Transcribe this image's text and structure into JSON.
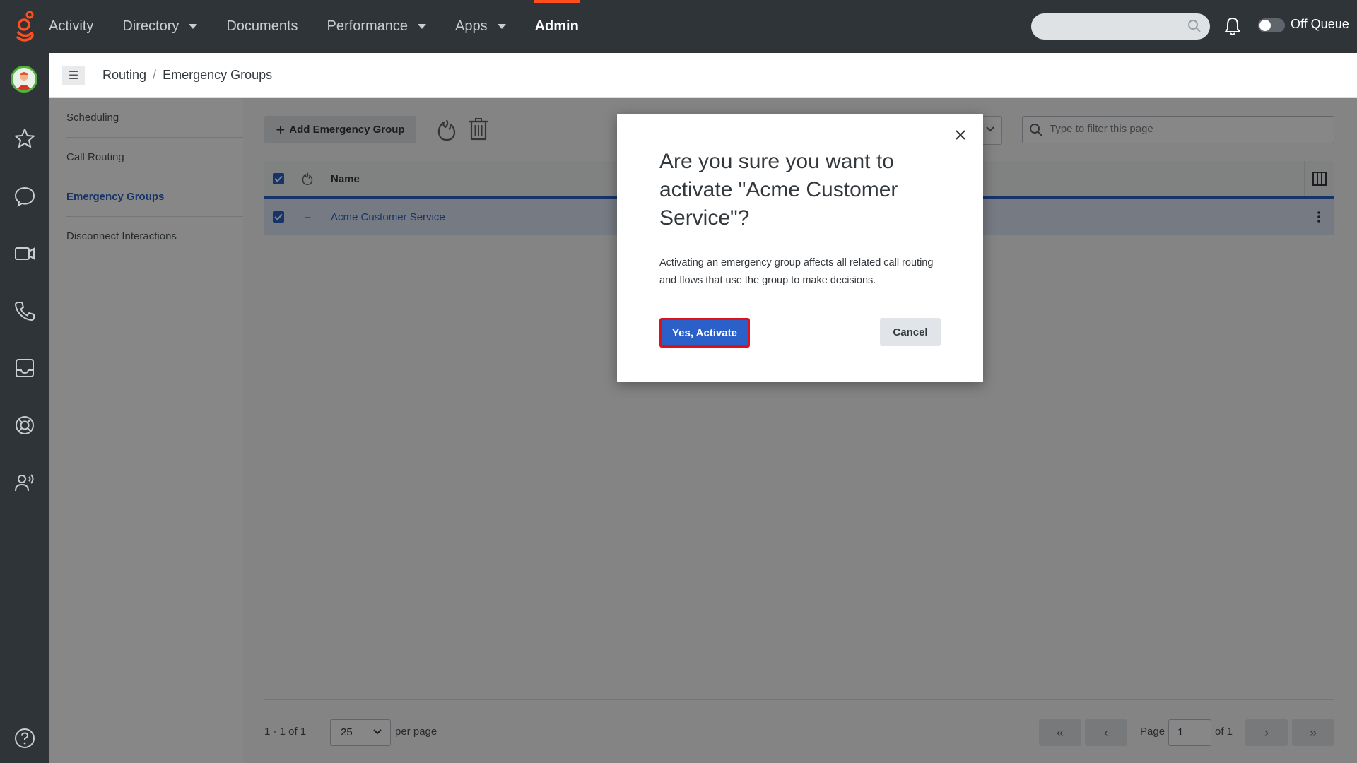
{
  "topbar": {
    "nav": [
      {
        "label": "Activity",
        "has_caret": false,
        "active": false
      },
      {
        "label": "Directory",
        "has_caret": true,
        "active": false
      },
      {
        "label": "Documents",
        "has_caret": false,
        "active": false
      },
      {
        "label": "Performance",
        "has_caret": true,
        "active": false
      },
      {
        "label": "Apps",
        "has_caret": true,
        "active": false
      },
      {
        "label": "Admin",
        "has_caret": false,
        "active": true
      }
    ],
    "search_placeholder": "",
    "queue_status": "Off Queue"
  },
  "breadcrumb": {
    "parent": "Routing",
    "separator": "/",
    "current": "Emergency Groups"
  },
  "subnav": [
    {
      "label": "Scheduling",
      "active": false
    },
    {
      "label": "Call Routing",
      "active": false
    },
    {
      "label": "Emergency Groups",
      "active": true
    },
    {
      "label": "Disconnect Interactions",
      "active": false
    }
  ],
  "toolbar": {
    "add_label": "Add Emergency Group",
    "filter_placeholder": "Type to filter this page"
  },
  "table": {
    "columns": [
      "Name"
    ],
    "rows": [
      {
        "selected": true,
        "status": "–",
        "name": "Acme Customer Service"
      }
    ]
  },
  "pagination": {
    "count_text": "1 - 1 of 1",
    "per_page_value": "25",
    "per_page_label": "per page",
    "page_label": "Page",
    "page_value": "1",
    "of_label": "of 1"
  },
  "modal": {
    "title": "Are you sure you want to activate \"Acme Customer Service\"?",
    "body": "Activating an emergency group affects all related call routing and flows that use the group to make decisions.",
    "confirm_label": "Yes, Activate",
    "cancel_label": "Cancel"
  },
  "colors": {
    "topbar_bg": "#2f3439",
    "accent": "#ff4f1f",
    "primary": "#2a60c8",
    "highlight_border": "#e0101a"
  }
}
